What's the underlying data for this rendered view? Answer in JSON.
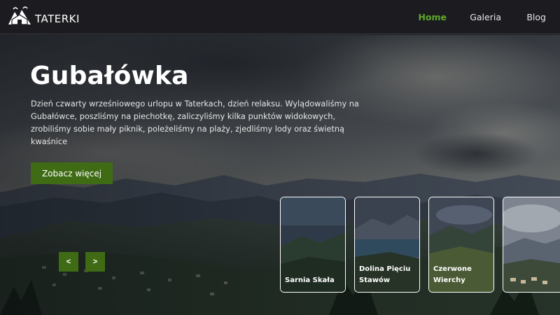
{
  "header": {
    "brand": "TATERKI",
    "logo_icon": "mountain-hut-logo",
    "nav": [
      {
        "label": "Home",
        "active": true
      },
      {
        "label": "Galeria",
        "active": false
      },
      {
        "label": "Blog",
        "active": false
      }
    ]
  },
  "hero": {
    "title": "Gubałówka",
    "description": "Dzień czwarty wrześniowego urlopu w Taterkach, dzień relaksu. Wylądowaliśmy na Gubałówce, poszliśmy na piechotkę, zaliczyliśmy kilka punktów widokowych, zrobiliśmy sobie mały piknik, poleżeliśmy na plaży, zjedliśmy lody oraz świetną kwaśnice",
    "cta_label": "Zobacz więcej",
    "prev_label": "<",
    "next_label": ">"
  },
  "cards": [
    {
      "label": "Sarnia Skała"
    },
    {
      "label": "Dolina Pięciu Stawów"
    },
    {
      "label": "Czerwone Wierchy"
    },
    {
      "label": ""
    }
  ],
  "colors": {
    "accent_green": "#3f6b14",
    "nav_active": "#5fa82a",
    "header_bg": "#1c1c20"
  }
}
